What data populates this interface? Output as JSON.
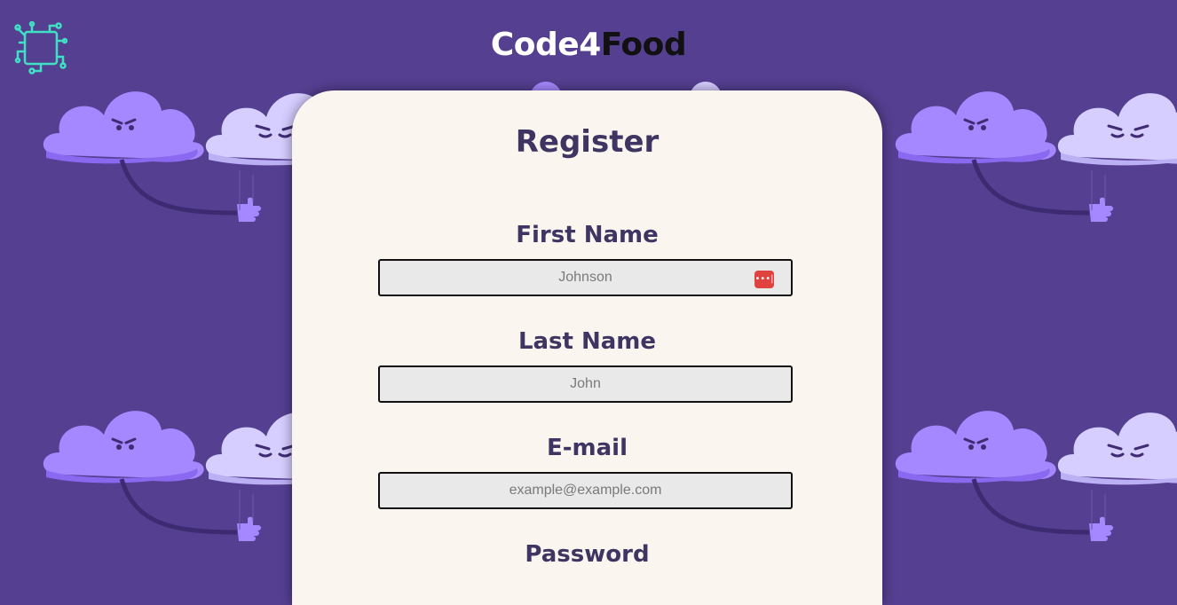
{
  "header": {
    "brand_part1": "Code4",
    "brand_part2": "Food"
  },
  "form": {
    "title": "Register",
    "fields": [
      {
        "label": "First Name",
        "placeholder": "Johnson"
      },
      {
        "label": "Last Name",
        "placeholder": "John"
      },
      {
        "label": "E-mail",
        "placeholder": "example@example.com"
      },
      {
        "label": "Password",
        "placeholder": ""
      }
    ]
  },
  "colors": {
    "background": "#553f91",
    "card": "#faf6ef",
    "heading": "#3f3563",
    "logo": "#3fe0c4",
    "cloud_dark": "#a588ff",
    "cloud_light": "#d6ceff"
  },
  "icons": {
    "logo": "circuit-logo-icon",
    "password_manager": "password-manager-icon"
  }
}
